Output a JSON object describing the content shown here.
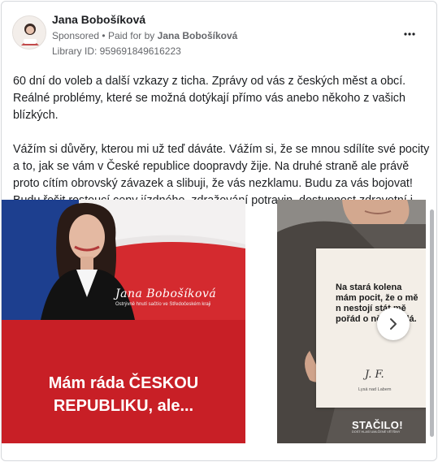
{
  "header": {
    "page_name": "Jana Bobošíková",
    "sponsored": "Sponsored",
    "separator": "•",
    "paid_for_by_prefix": "Paid for by",
    "paid_for_by_name": "Jana Bobošíková",
    "library_id": "Library ID: 959691849616223",
    "more_icon": "more-horizontal-icon"
  },
  "body": {
    "paragraph_1": "60 dní do voleb a další vzkazy z ticha. Zprávy od vás z českých měst a obcí. Reálné problémy, které se možná dotýkají přímo vás anebo někoho z vašich blízkých.",
    "paragraph_2": "Vážím si důvěry, kterou mi už teď dáváte. Vážím si, že se mnou sdílíte své pocity a to, jak se vám v České republice doopravdy žije. Na druhé straně ale právě proto cítím obrovský závazek a slibuji, že vás nezklamu. Budu za vás bojovat! Budu řešit rostoucí ceny jízdného, zdražování potravin, dostupnost zdravotní i sociální péče...."
  },
  "carousel": {
    "card_1": {
      "signature": "Jana Bobošíková",
      "caption": "Ostrývně hnutí sačtío ve Středočeském kraji",
      "headline_line_1": "Mám ráda ČESKOU",
      "headline_line_2": "REPUBLIKU, ale..."
    },
    "card_2": {
      "quote": "Na stará kolena mám pocit, že o mě n nestojí stát mě pořád o něco žádá.",
      "initials": "J. F.",
      "place": "Lysá nad Labem",
      "logo": "STAČILO!",
      "logo_sub": "DOST HLASÍ UMLČENÉ VĚTŠINY"
    },
    "next_icon": "chevron-right-icon"
  },
  "colors": {
    "text": "#1c1e21",
    "muted": "#65676b",
    "flag_red": "#c81f26",
    "flag_blue": "#1d3f8f"
  }
}
